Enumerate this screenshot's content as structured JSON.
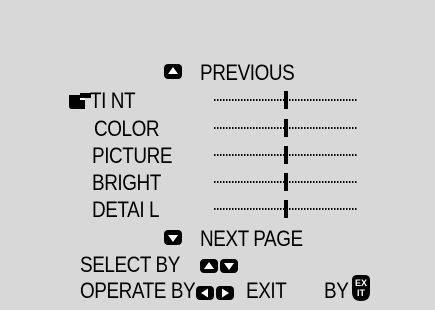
{
  "menu": {
    "previous_label": "PREVIOUS",
    "next_label": "NEXT PAGE",
    "items": [
      {
        "label": "TI NT",
        "value_fraction": 0.5,
        "selected": true
      },
      {
        "label": "COLOR",
        "value_fraction": 0.5,
        "selected": false
      },
      {
        "label": "PICTURE",
        "value_fraction": 0.5,
        "selected": false
      },
      {
        "label": "BRIGHT",
        "value_fraction": 0.5,
        "selected": false
      },
      {
        "label": "DETAI L",
        "value_fraction": 0.5,
        "selected": false
      }
    ]
  },
  "help": {
    "select_label": "SELECT  BY",
    "operate_label": "OPERATE BY",
    "exit_label": "EXIT",
    "by_label": "BY",
    "exit_button_text": "EX IT"
  },
  "icons": {
    "previous": "up-arrow-icon",
    "next": "down-arrow-icon",
    "cursor": "pointing-hand-icon",
    "select": [
      "up-arrow-icon",
      "down-arrow-icon"
    ],
    "operate": [
      "left-arrow-icon",
      "right-arrow-icon"
    ],
    "exit": "exit-button-icon"
  },
  "colors": {
    "background": "#d8d8d8",
    "foreground": "#000000"
  }
}
